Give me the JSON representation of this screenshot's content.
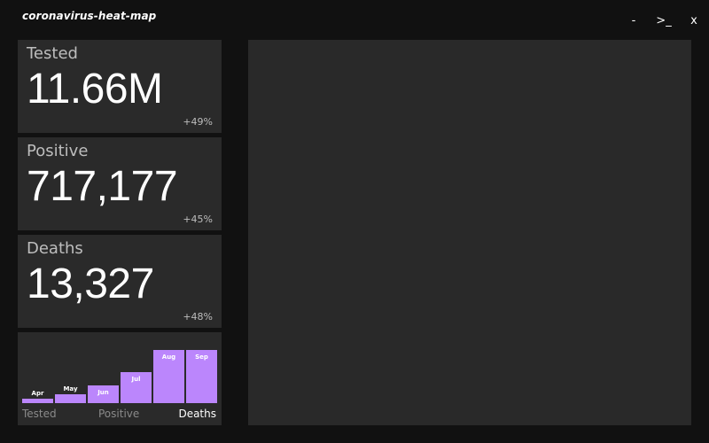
{
  "app": {
    "title": "coronavirus-heat-map"
  },
  "window_controls": {
    "minimize": "-",
    "terminal": ">_",
    "close": "x"
  },
  "stats": {
    "tested": {
      "label": "Tested",
      "value": "11.66M",
      "delta": "+49%"
    },
    "positive": {
      "label": "Positive",
      "value": "717,177",
      "delta": "+45%"
    },
    "deaths": {
      "label": "Deaths",
      "value": "13,327",
      "delta": "+48%"
    }
  },
  "chart_tabs": {
    "tested": "Tested",
    "positive": "Positive",
    "deaths": "Deaths",
    "active": "Deaths"
  },
  "colors": {
    "background": "#111111",
    "card": "#2a2a2a",
    "map_panel": "#292929",
    "bar": "#bb86fc",
    "muted_text": "#bdbdbd"
  },
  "chart_data": {
    "type": "bar",
    "categories": [
      "Apr",
      "May",
      "Jun",
      "Jul",
      "Aug",
      "Sep"
    ],
    "values": [
      5,
      10,
      20,
      35,
      60,
      60
    ],
    "ylim": [
      0,
      60
    ],
    "grid": false,
    "legend": "none",
    "title": "",
    "xlabel": "",
    "ylabel": ""
  }
}
